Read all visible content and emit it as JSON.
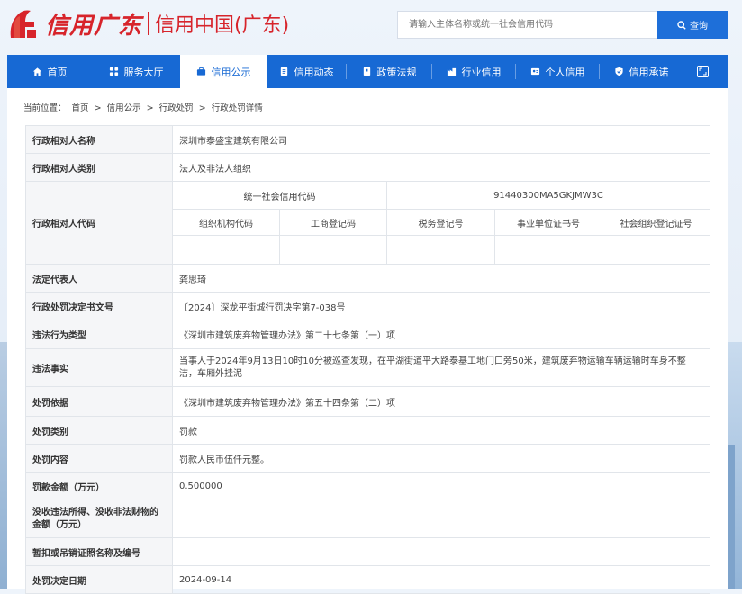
{
  "header": {
    "logo_text": "信用广东",
    "site_title": "信用中国(广东)",
    "search_placeholder": "请输入主体名称或统一社会信用代码",
    "search_button": "查询",
    "brand_color": "#1769d4",
    "logo_color": "#d7242b"
  },
  "nav": {
    "items": [
      {
        "label": "首页",
        "icon": "home-icon"
      },
      {
        "label": "服务大厅",
        "icon": "grid-icon"
      },
      {
        "label": "信用公示",
        "icon": "briefcase-icon",
        "active": true
      },
      {
        "label": "信用动态",
        "icon": "document-icon"
      },
      {
        "label": "政策法规",
        "icon": "book-icon"
      },
      {
        "label": "行业信用",
        "icon": "industry-icon"
      },
      {
        "label": "个人信用",
        "icon": "id-card-icon"
      },
      {
        "label": "信用承诺",
        "icon": "shield-icon"
      }
    ],
    "expand_icon": "fullscreen-icon"
  },
  "breadcrumb": {
    "prefix": "当前位置：",
    "items": [
      "首页",
      "信用公示",
      "行政处罚",
      "行政处罚详情"
    ],
    "separator": ">"
  },
  "detail": {
    "name_label": "行政相对人名称",
    "name_value": "深圳市泰盛宝建筑有限公司",
    "type_label": "行政相对人类别",
    "type_value": "法人及非法人组织",
    "code_label": "行政相对人代码",
    "uscc_label": "统一社会信用代码",
    "uscc_value": "91440300MA5GKJMW3C",
    "code_headers": [
      "组织机构代码",
      "工商登记码",
      "税务登记号",
      "事业单位证书号",
      "社会组织登记证号"
    ],
    "code_values": [
      "",
      "",
      "",
      "",
      ""
    ],
    "legal_rep_label": "法定代表人",
    "legal_rep_value": "龚思琦",
    "doc_no_label": "行政处罚决定书文号",
    "doc_no_value": "〔2024〕深龙平街城行罚决字第7-038号",
    "violation_type_label": "违法行为类型",
    "violation_type_value": "《深圳市建筑废弃物管理办法》第二十七条第（一）项",
    "facts_label": "违法事实",
    "facts_value": "当事人于2024年9月13日10时10分被巡查发现，在平湖街道平大路泰基工地门口旁50米，建筑废弃物运输车辆运输时车身不整洁，车厢外挂泥",
    "basis_label": "处罚依据",
    "basis_value": "《深圳市建筑废弃物管理办法》第五十四条第（二）项",
    "category_label": "处罚类别",
    "category_value": "罚款",
    "content_label": "处罚内容",
    "content_value": "罚款人民币伍仟元整。",
    "amount_label": "罚款金额（万元）",
    "amount_value": "0.500000",
    "confiscation_label": "没收违法所得、没收非法财物的金额（万元）",
    "confiscation_value": "",
    "license_label": "暂扣或吊销证照名称及编号",
    "license_value": "",
    "date_label": "处罚决定日期",
    "date_value": "2024-09-14"
  }
}
